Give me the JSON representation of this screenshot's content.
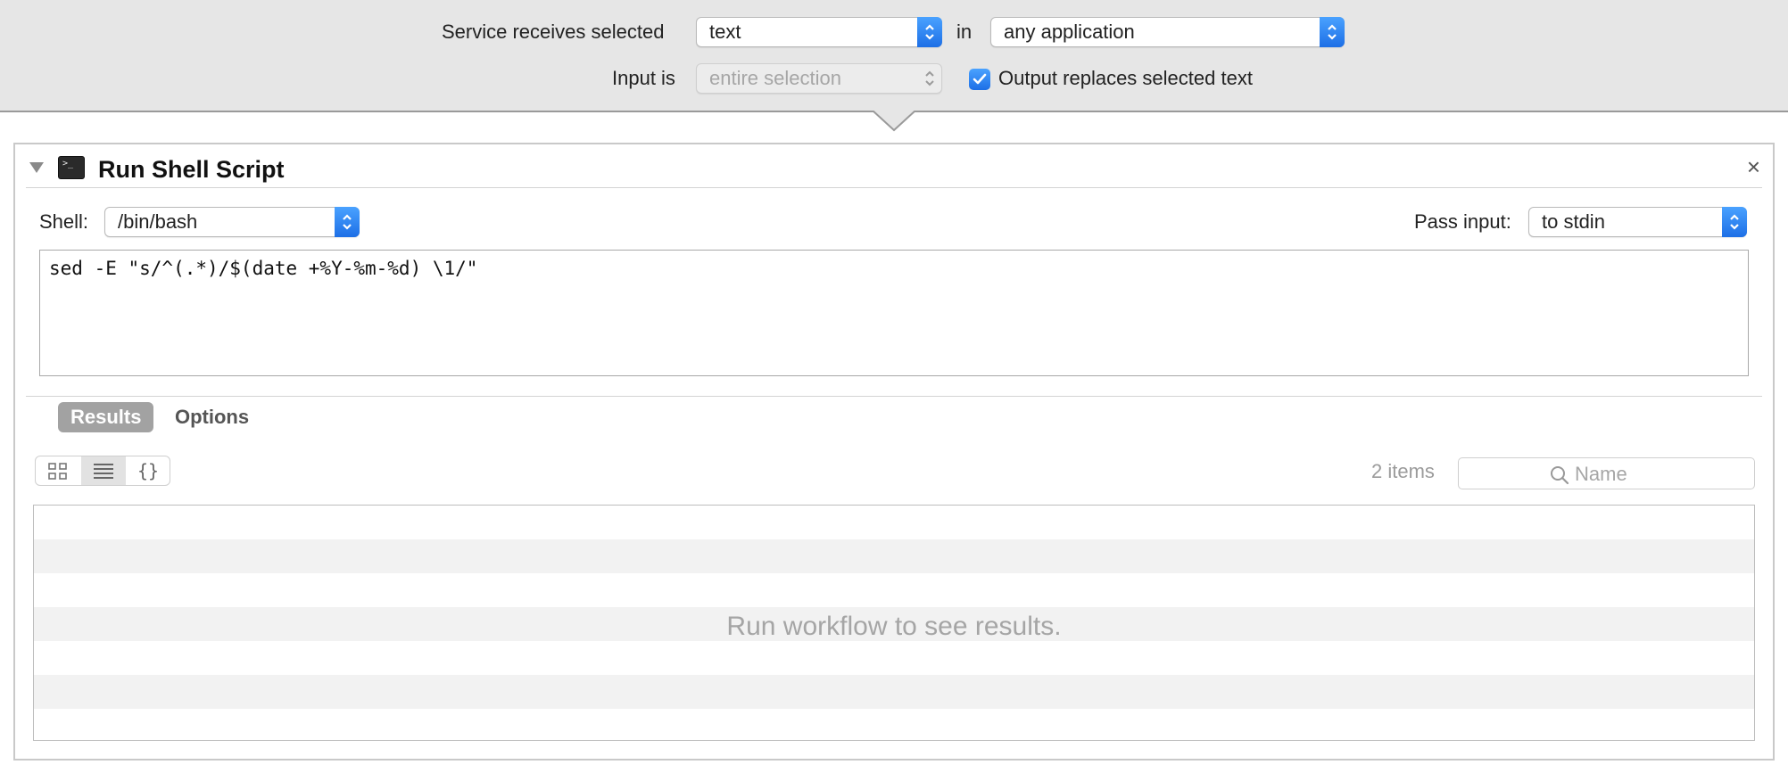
{
  "service": {
    "receives_label": "Service receives selected",
    "input_type": "text",
    "in_label": "in",
    "application": "any application",
    "input_is_label": "Input is",
    "input_is_value": "entire selection",
    "output_replaces_label": "Output replaces selected text",
    "output_replaces_checked": true
  },
  "action": {
    "title": "Run Shell Script",
    "shell_label": "Shell:",
    "shell_value": "/bin/bash",
    "pass_input_label": "Pass input:",
    "pass_input_value": "to stdin",
    "script": "sed -E \"s/^(.*)/$(date +%Y-%m-%d) \\1/\"",
    "close_glyph": "×"
  },
  "results": {
    "tabs": [
      {
        "label": "Results",
        "active": true
      },
      {
        "label": "Options",
        "active": false
      }
    ],
    "view_modes": [
      "icon-view",
      "list-view",
      "source-view"
    ],
    "selected_view": "list-view",
    "braces_glyph": "{}",
    "items_count": "2 items",
    "search_placeholder": "Name",
    "empty_message": "Run workflow to see results."
  },
  "colors": {
    "accent": "#2f86f5",
    "header_bg": "#e6e6e6",
    "active_tab": "#a2a2a2"
  }
}
